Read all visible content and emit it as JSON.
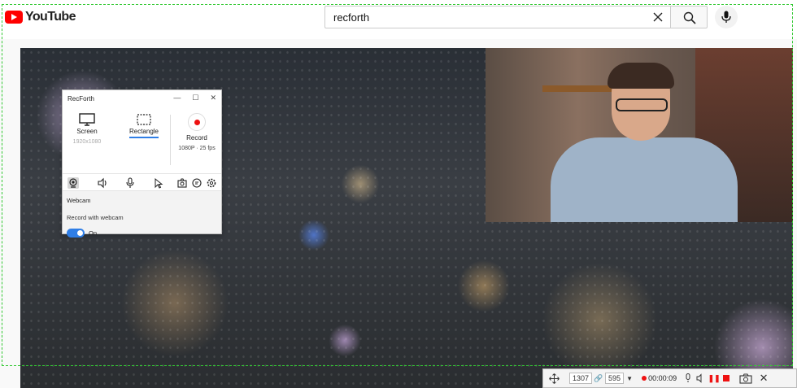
{
  "youtube": {
    "logo_text": "YouTube",
    "search_value": "recforth"
  },
  "recforth": {
    "title": "RecForth",
    "modes": [
      {
        "label": "Screen",
        "sub": "1920x1080"
      },
      {
        "label": "Rectangle",
        "sub": ""
      },
      {
        "label": "Record",
        "sub": "1080P · 25 fps"
      }
    ],
    "section_title": "Webcam",
    "option_label": "Record with webcam",
    "toggle_label": "On",
    "toggle_on": true
  },
  "rec_bar": {
    "width": "1307",
    "height": "595",
    "timer": "00:00:09"
  },
  "colors": {
    "accent": "#2f7ee6",
    "record": "#ee1111",
    "selection_border": "#32c832"
  }
}
